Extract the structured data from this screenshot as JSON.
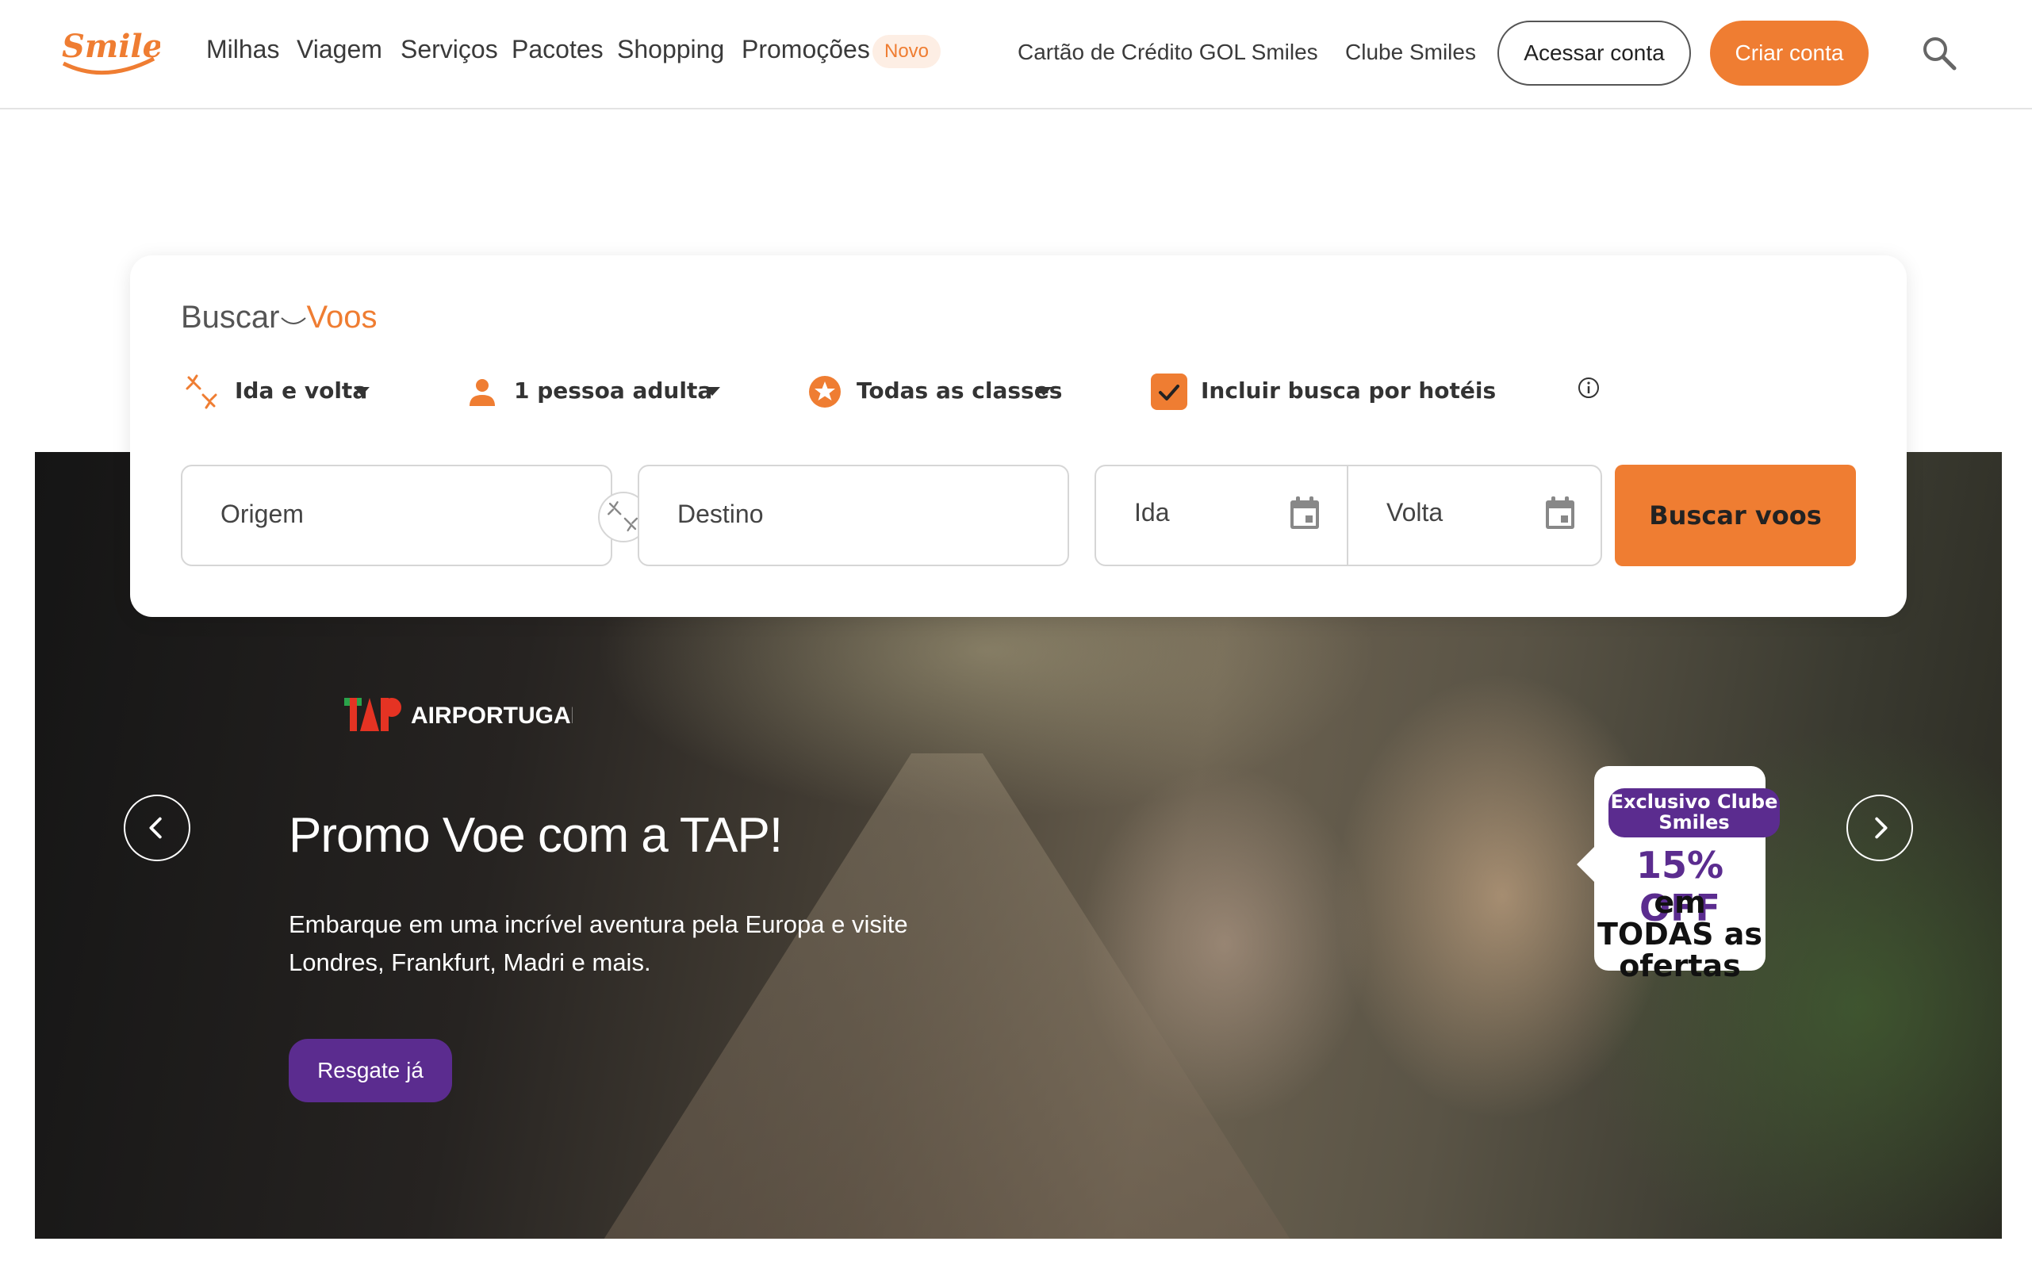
{
  "header": {
    "logo_text": "Smiles",
    "nav": [
      "Milhas",
      "Viagem",
      "Serviços",
      "Pacotes",
      "Shopping",
      "Promoções"
    ],
    "new_badge": "Novo",
    "credit_card_link": "Cartão de Crédito GOL Smiles",
    "club_link": "Clube Smiles",
    "login_label": "Acessar conta",
    "signup_label": "Criar conta"
  },
  "search": {
    "title_part1": "Buscar",
    "title_part2": "Voos",
    "trip_type": "Ida e volta",
    "passengers": "1 pessoa adulta",
    "cabin_class": "Todas as classes",
    "include_hotels_label": "Incluir busca por hotéis",
    "include_hotels_checked": true,
    "origin_placeholder": "Origem",
    "destination_placeholder": "Destino",
    "departure_placeholder": "Ida",
    "return_placeholder": "Volta",
    "submit_label": "Buscar voos"
  },
  "hero": {
    "partner_logo_text": "AIRPORTUGAL",
    "title": "Promo Voe com a TAP!",
    "description": "Embarque em uma incrível aventura pela Europa e visite Londres, Frankfurt, Madri e mais.",
    "cta_label": "Resgate já",
    "promo": {
      "pill": "Exclusivo Clube Smiles",
      "discount": "15% OFF",
      "subtext": "em TODAS as ofertas"
    }
  },
  "colors": {
    "brand_orange": "#ef7d32",
    "brand_purple": "#5b2c8f"
  },
  "icons": [
    "smiles-logo",
    "search-icon",
    "plane-icon",
    "person-icon",
    "star-icon",
    "checkbox-checked-icon",
    "info-icon",
    "swap-icon",
    "calendar-icon",
    "chevron-left-icon",
    "chevron-right-icon",
    "tap-logo"
  ]
}
